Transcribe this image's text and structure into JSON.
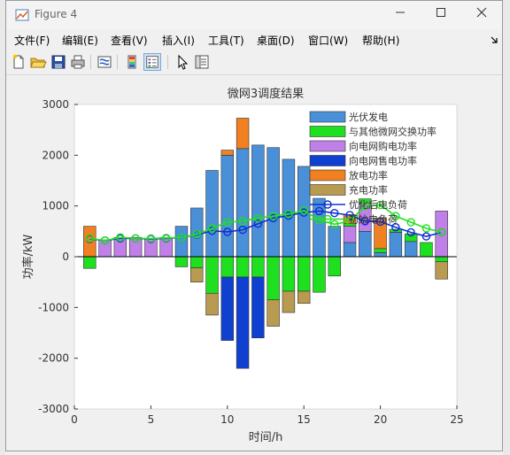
{
  "window": {
    "title": "Figure 4"
  },
  "menu": [
    "文件(F)",
    "编辑(E)",
    "查看(V)",
    "插入(I)",
    "工具(T)",
    "桌面(D)",
    "窗口(W)",
    "帮助(H)"
  ],
  "toolbar_icons": [
    "new-figure-icon",
    "open-folder-icon",
    "save-icon",
    "print-icon",
    "link-plot-icon",
    "colorbar-icon",
    "legend-icon",
    "pointer-icon",
    "property-inspector-icon"
  ],
  "chart_data": {
    "type": "bar",
    "title": "微网3调度结果",
    "xlabel": "时间/h",
    "ylabel": "功率/kW",
    "xlim": [
      0,
      25
    ],
    "ylim": [
      -3000,
      3000
    ],
    "xticks": [
      0,
      5,
      10,
      15,
      20,
      25
    ],
    "yticks": [
      -3000,
      -2000,
      -1000,
      0,
      1000,
      2000,
      3000
    ],
    "legend_position": "top-right",
    "x": [
      1,
      2,
      3,
      4,
      5,
      6,
      7,
      8,
      9,
      10,
      11,
      12,
      13,
      14,
      15,
      16,
      17,
      18,
      19,
      20,
      21,
      22,
      23,
      24
    ],
    "series": [
      {
        "name": "光伏发电",
        "color": "#4a90d9",
        "kind": "bar",
        "values": [
          0,
          0,
          0,
          0,
          0,
          0,
          0,
          0,
          0,
          0,
          0,
          0,
          0,
          0,
          0,
          0,
          0,
          0,
          0,
          0,
          0,
          0,
          0,
          0
        ]
      },
      {
        "name": "与其他微网交换功率",
        "color": "#1fe01f",
        "kind": "bar",
        "values": [
          -230,
          0,
          0,
          0,
          0,
          0,
          -200,
          -220,
          -720,
          -400,
          -400,
          -400,
          -850,
          -680,
          -680,
          -700,
          -380,
          50,
          80,
          80,
          60,
          150,
          280,
          -100
        ]
      },
      {
        "name": "向电网购电功率",
        "color": "#c080e8",
        "kind": "bar",
        "values": [
          0,
          330,
          380,
          380,
          360,
          380,
          0,
          0,
          0,
          0,
          0,
          0,
          0,
          0,
          0,
          0,
          0,
          0,
          0,
          0,
          0,
          0,
          0,
          900
        ]
      },
      {
        "name": "向电网售电功率",
        "color": "#1040d0",
        "kind": "bar",
        "values": [
          0,
          0,
          0,
          0,
          0,
          0,
          0,
          0,
          0,
          -1250,
          -1800,
          -1200,
          0,
          0,
          0,
          0,
          0,
          0,
          0,
          0,
          0,
          0,
          0,
          0
        ]
      },
      {
        "name": "放电功率",
        "color": "#f08020",
        "kind": "bar",
        "values": [
          600,
          0,
          0,
          0,
          0,
          0,
          0,
          0,
          0,
          100,
          600,
          0,
          0,
          0,
          0,
          0,
          0,
          0,
          0,
          0,
          0,
          0,
          0,
          0
        ]
      },
      {
        "name": "充电功率",
        "color": "#b89a50",
        "kind": "bar",
        "values": [
          0,
          0,
          0,
          0,
          0,
          0,
          0,
          -280,
          -430,
          0,
          0,
          0,
          -520,
          -420,
          -240,
          0,
          0,
          0,
          0,
          0,
          0,
          0,
          0,
          -340
        ]
      },
      {
        "name": "优化后电负荷",
        "color": "#1030d0",
        "kind": "line",
        "values": [
          350,
          320,
          360,
          360,
          350,
          360,
          380,
          430,
          510,
          490,
          530,
          650,
          760,
          810,
          870,
          900,
          860,
          820,
          700,
          690,
          580,
          480,
          400,
          480
        ]
      },
      {
        "name": "初始电负荷",
        "color": "#20e020",
        "kind": "line",
        "values": [
          360,
          320,
          380,
          360,
          360,
          370,
          380,
          440,
          560,
          680,
          700,
          760,
          800,
          840,
          910,
          720,
          640,
          700,
          1000,
          1020,
          800,
          680,
          560,
          480
        ]
      }
    ],
    "bar_stacks": {
      "positive": [
        [
          600,
          0,
          0,
          0,
          0,
          0,
          600,
          960,
          1700,
          2000,
          2100,
          2200,
          2150,
          1920,
          1780,
          1150,
          600,
          360,
          440,
          350,
          450,
          300,
          0,
          0
        ],
        [
          0,
          0,
          0,
          0,
          0,
          0,
          0,
          0,
          0,
          2100,
          2720,
          0,
          0,
          0,
          0,
          0,
          0,
          0,
          0,
          0,
          0,
          0,
          0,
          0
        ]
      ]
    },
    "pv_values": [
      0,
      0,
      0,
      0,
      0,
      0,
      600,
      960,
      1700,
      2000,
      2130,
      2200,
      2150,
      1920,
      1780,
      1150,
      600,
      280,
      500,
      80,
      480,
      300,
      0,
      0
    ],
    "buy_values": [
      0,
      330,
      380,
      380,
      360,
      380,
      0,
      0,
      0,
      0,
      0,
      0,
      0,
      0,
      0,
      0,
      0,
      320,
      560,
      0,
      0,
      0,
      0,
      900
    ],
    "discharge_values": [
      600,
      0,
      0,
      0,
      0,
      0,
      0,
      0,
      0,
      100,
      600,
      0,
      0,
      0,
      0,
      0,
      0,
      180,
      0,
      600,
      0,
      0,
      0,
      0
    ]
  }
}
